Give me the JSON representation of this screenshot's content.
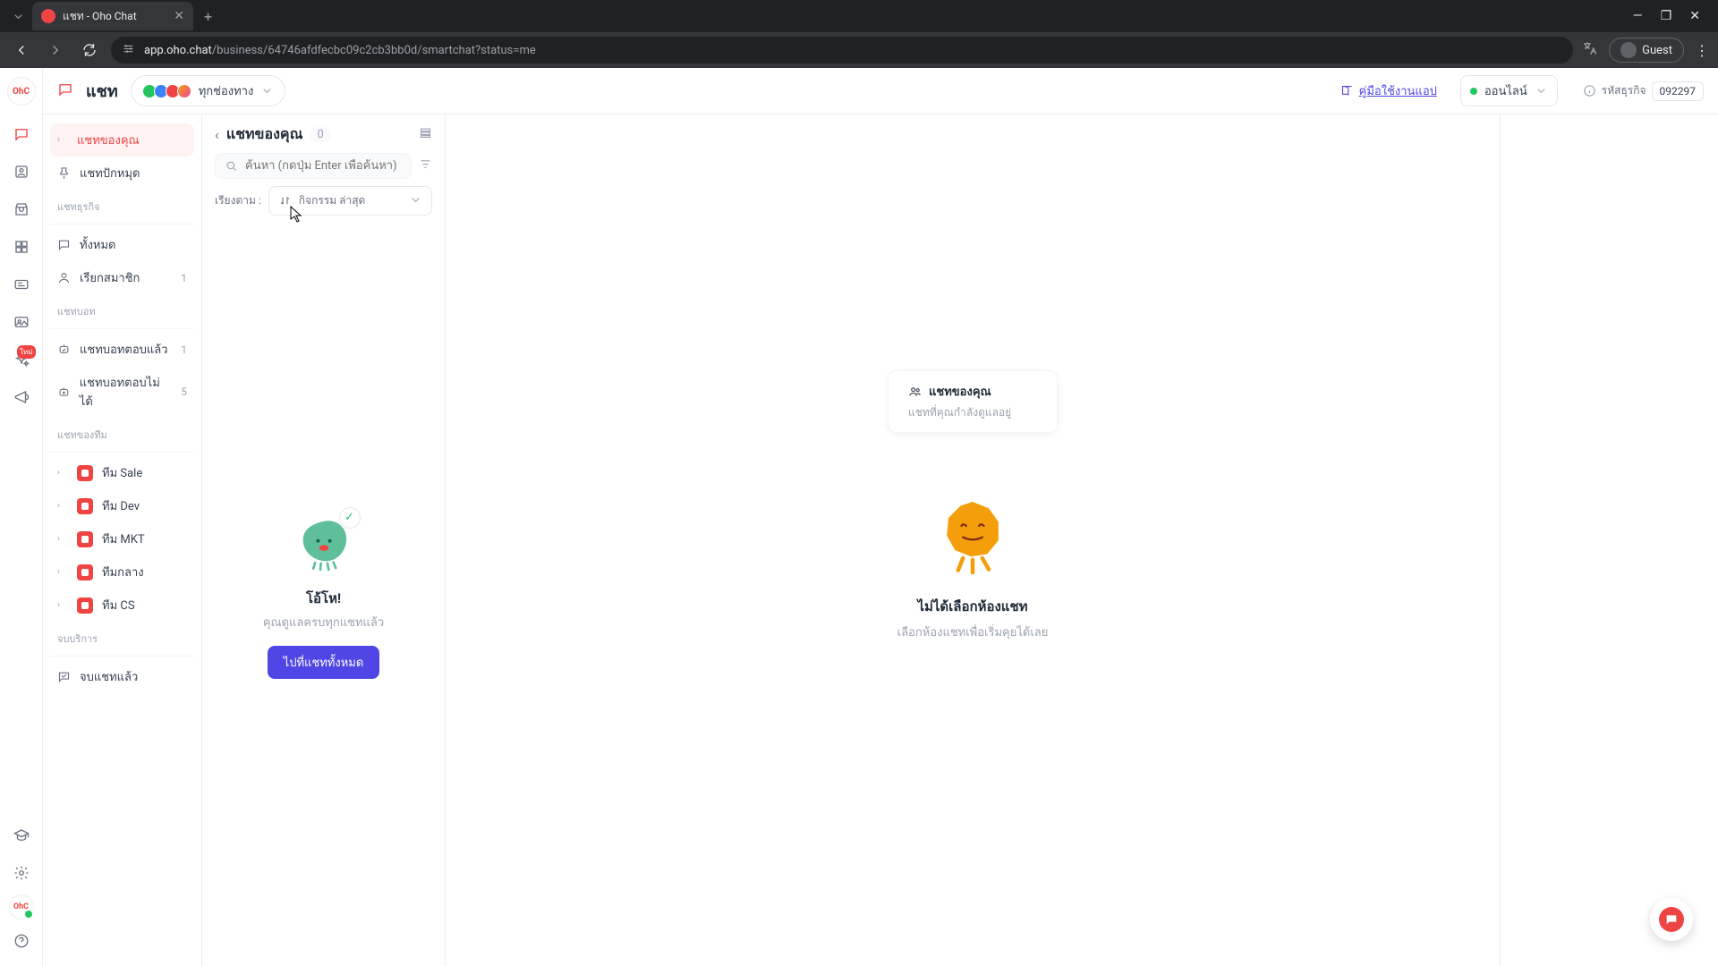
{
  "browser": {
    "tab_title": "แชท - Oho Chat",
    "url_prefix": "app.oho.chat",
    "url_path": "/business/64746afdfecbc09c2cb3bb0d/smartchat?status=me",
    "guest_label": "Guest"
  },
  "header": {
    "title": "แชท",
    "channel_label": "ทุกช่องทาง",
    "manual_link": "คู่มือใช้งานแอป",
    "status_label": "ออนไลน์",
    "biz_label": "รหัสธุรกิจ",
    "biz_code": "092297"
  },
  "sidebar": {
    "your_chat": "แชทของคุณ",
    "pinned": "แชทปักหมุด",
    "section_biz": "แชทธุรกิจ",
    "all": "ทั้งหมด",
    "call_member": "เรียกสมาชิก",
    "call_member_count": "1",
    "section_bot": "แชทบอท",
    "bot_answered": "แชทบอทตอบแล้ว",
    "bot_answered_count": "1",
    "bot_unanswered": "แชทบอทตอบไม่ได้",
    "bot_unanswered_count": "5",
    "section_team": "แชทของทีม",
    "teams": [
      "ทีม Sale",
      "ทีม Dev",
      "ทีม MKT",
      "ทีมกลาง",
      "ทีม CS"
    ],
    "section_end": "จบบริการ",
    "ended": "จบแชทแล้ว"
  },
  "list": {
    "title": "แชทของคุณ",
    "count": "0",
    "search_placeholder": "ค้นหา (กดปุ่ม Enter เพื่อค้นหา)",
    "sort_label": "เรียงตาม :",
    "sort_value": "กิจกรรม ล่าสุด",
    "empty_title": "โอ้โห!",
    "empty_sub": "คุณดูแลครบทุกแชทแล้ว",
    "empty_btn": "ไปที่แชททั้งหมด"
  },
  "tooltip": {
    "title": "แชทของคุณ",
    "sub": "แชทที่คุณกำลังดูแลอยู่"
  },
  "detail": {
    "title": "ไม่ได้เลือกห้องแชท",
    "sub": "เลือกห้องแชทเพื่อเริ่มคุยได้เลย"
  },
  "rail": {
    "badge": "ใหม่"
  }
}
